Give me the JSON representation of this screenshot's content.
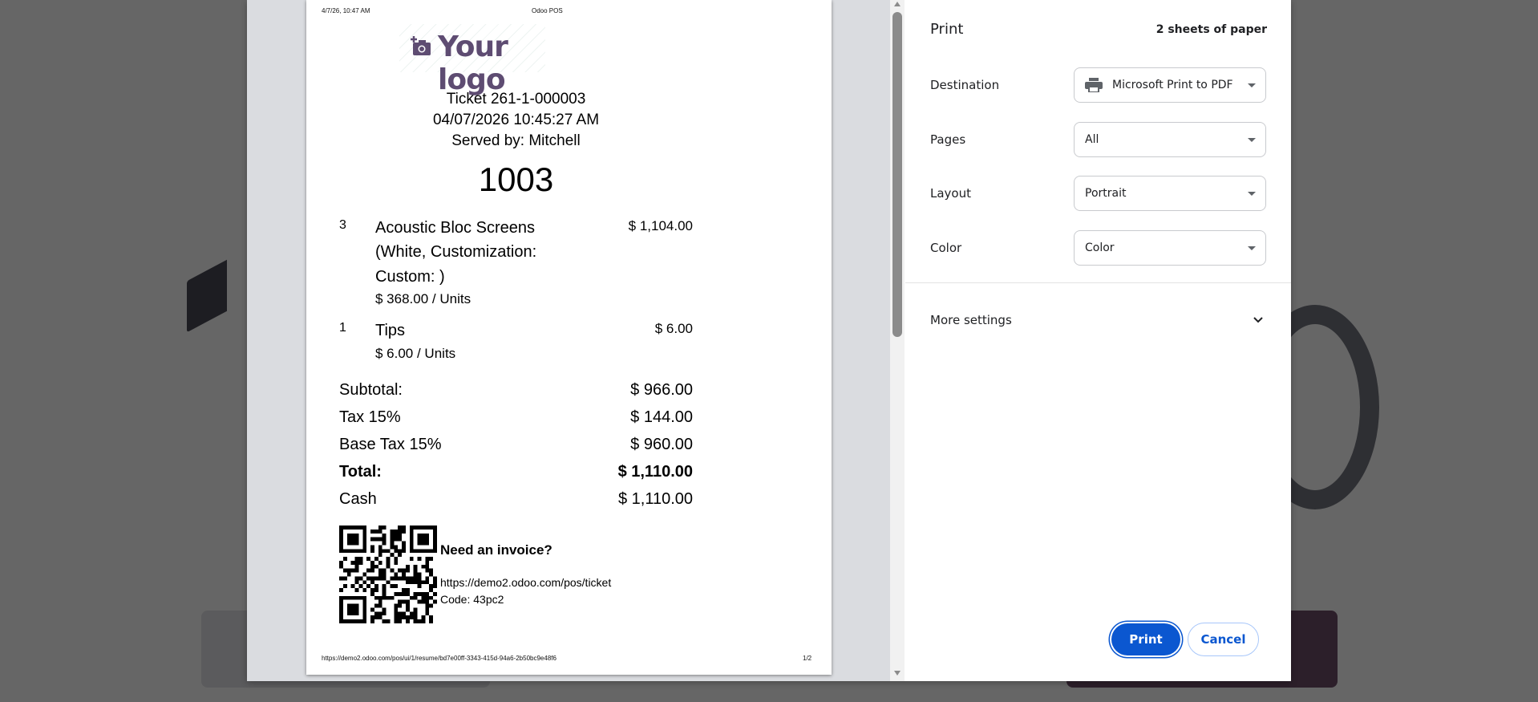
{
  "receipt": {
    "header_date": "4/7/26, 10:47 AM",
    "header_title": "Odoo POS",
    "logo_text": "Your logo",
    "ticket": "Ticket 261-1-000003",
    "datetime": "04/07/2026 10:45:27 AM",
    "served_by": "Served by: Mitchell",
    "order_number": "1003",
    "lines": [
      {
        "qty": "3",
        "name_l1": "Acoustic Bloc Screens",
        "name_l2": "(White, Customization:",
        "name_l3": "Custom: )",
        "unit": "$ 368.00 / Units",
        "price": "$ 1,104.00"
      },
      {
        "qty": "1",
        "name_l1": "Tips",
        "unit": "$ 6.00 / Units",
        "price": "$ 6.00"
      }
    ],
    "totals": [
      {
        "label": "Subtotal:",
        "value": "$ 966.00"
      },
      {
        "label": "Tax 15%",
        "value": "$ 144.00"
      },
      {
        "label": "Base Tax 15%",
        "value": "$ 960.00"
      },
      {
        "label": "Total:",
        "value": "$ 1,110.00"
      },
      {
        "label": "Cash",
        "value": "$ 1,110.00"
      }
    ],
    "invoice_title": "Need an invoice?",
    "invoice_url": "https://demo2.odoo.com/pos/ticket",
    "invoice_code": "Code: 43pc2",
    "footer_url": "https://demo2.odoo.com/pos/ui/1/resume/bd7e00ff-3343-415d-94a6-2b50bc9e48f6",
    "footer_page": "1/2"
  },
  "settings": {
    "title": "Print",
    "sheets": "2 sheets of paper",
    "destination_label": "Destination",
    "destination_value": "Microsoft Print to PDF",
    "pages_label": "Pages",
    "pages_value": "All",
    "layout_label": "Layout",
    "layout_value": "Portrait",
    "color_label": "Color",
    "color_value": "Color",
    "more_settings": "More settings",
    "print_button": "Print",
    "cancel_button": "Cancel"
  },
  "colors": {
    "accent": "#0b57d0",
    "logo": "#5e4c72",
    "overlay": "#666666"
  }
}
